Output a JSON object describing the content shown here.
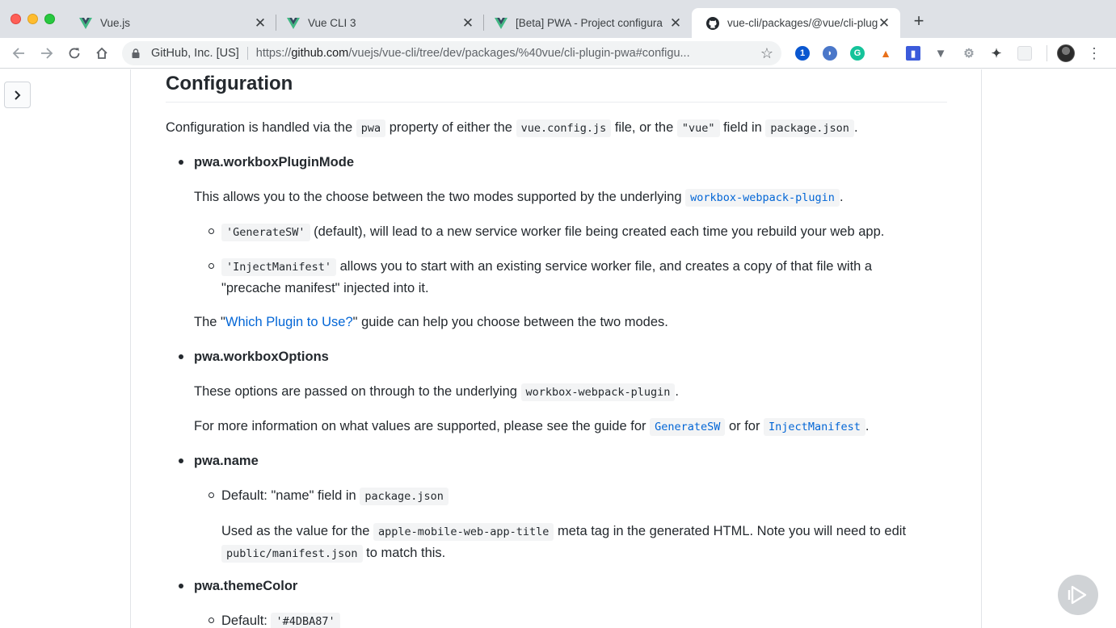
{
  "browser": {
    "tabs": [
      {
        "title": "Vue.js"
      },
      {
        "title": "Vue CLI 3"
      },
      {
        "title": "[Beta] PWA - Project configura"
      },
      {
        "title": "vue-cli/packages/@vue/cli-plug"
      }
    ],
    "close_glyph": "✕",
    "new_tab_glyph": "+",
    "omnibox": {
      "site_identity": "GitHub, Inc. [US]",
      "url_protocol": "https://",
      "url_host": "github.com",
      "url_path": "/vuejs/vue-cli/tree/dev/packages/%40vue/cli-plugin-pwa#configu..."
    },
    "extensions": [
      {
        "icon": "1password-icon",
        "color": "#0a57d0"
      },
      {
        "icon": "pocket-icon",
        "color": "#4a77c9"
      },
      {
        "icon": "grammarly-icon",
        "color": "#15c39a"
      },
      {
        "icon": "warning-extension-icon",
        "color": "#e8701a"
      },
      {
        "icon": "bookmark-extension-icon",
        "color": "#3b5bdb"
      },
      {
        "icon": "vue-devtools-icon",
        "color": "#6b7178"
      },
      {
        "icon": "gear-extension-icon",
        "color": "#9aa0a6"
      },
      {
        "icon": "puzzle-extension-icon",
        "color": "#3c4043"
      },
      {
        "icon": "blank-extension-icon",
        "color": "#dadce0"
      }
    ]
  },
  "doc": {
    "heading": "Configuration",
    "intro": {
      "t1": "Configuration is handled via the ",
      "c1": "pwa",
      "t2": " property of either the ",
      "c2": "vue.config.js",
      "t3": " file, or the ",
      "c3": "\"vue\"",
      "t4": " field in ",
      "c4": "package.json",
      "t5": "."
    },
    "workboxPluginMode": {
      "name": "pwa.workboxPluginMode",
      "desc_text": "This allows you to the choose between the two modes supported by the underlying ",
      "desc_link": "workbox-webpack-plugin",
      "desc_end": ".",
      "opt1_code": "'GenerateSW'",
      "opt1_text": " (default), will lead to a new service worker file being created each time you rebuild your web app.",
      "opt2_code": "'InjectManifest'",
      "opt2_text": " allows you to start with an existing service worker file, and creates a copy of that file with a \"precache manifest\" injected into it.",
      "guide_pre": "The \"",
      "guide_link": "Which Plugin to Use?",
      "guide_post": "\" guide can help you choose between the two modes."
    },
    "workboxOptions": {
      "name": "pwa.workboxOptions",
      "p1_text": "These options are passed on through to the underlying ",
      "p1_code": "workbox-webpack-plugin",
      "p1_end": ".",
      "p2_text": "For more information on what values are supported, please see the guide for ",
      "p2_link1": "GenerateSW",
      "p2_mid": " or for ",
      "p2_link2": "InjectManifest",
      "p2_end": "."
    },
    "name_opt": {
      "name": "pwa.name",
      "default_text": "Default: \"name\" field in ",
      "default_code": "package.json",
      "use_text1": "Used as the value for the ",
      "use_code1": "apple-mobile-web-app-title",
      "use_text2": " meta tag in the generated HTML. Note you will need to edit ",
      "use_code2": "public/manifest.json",
      "use_text3": " to match this."
    },
    "themeColor": {
      "name": "pwa.themeColor",
      "default_text": "Default: ",
      "default_code": "'#4DBA87'"
    }
  }
}
